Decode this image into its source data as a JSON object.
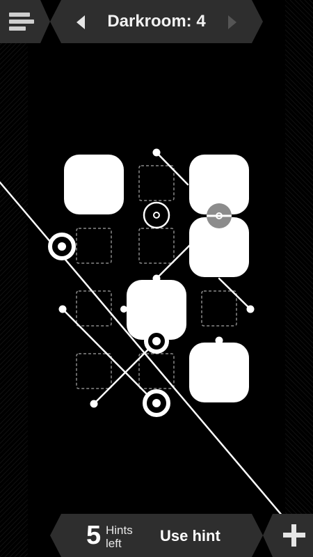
{
  "header": {
    "level_title": "Darkroom: 4",
    "menu_icon": "menu-icon",
    "prev_icon": "chevron-left-icon",
    "next_icon": "chevron-right-icon"
  },
  "footer": {
    "hints_count": "5",
    "hints_label_line1": "Hints",
    "hints_label_line2": "left",
    "use_hint_label": "Use hint",
    "add_icon": "plus-icon"
  },
  "colors": {
    "background": "#000000",
    "bar": "#2e2e2e",
    "tile": "#ffffff",
    "empty_slot": "#8a8a8a",
    "disabled_arrow": "#555555"
  },
  "board": {
    "grid": "4x4",
    "tiles_placed": 4,
    "empty_slots": 8
  }
}
